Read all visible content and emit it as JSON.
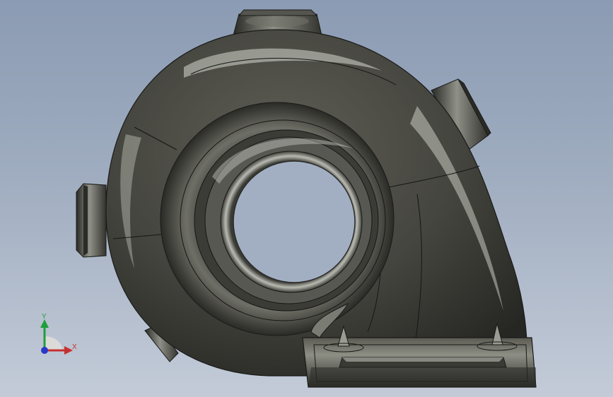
{
  "viewport": {
    "background_top": "#8b9bb3",
    "background_bottom": "#c3cbd8"
  },
  "model": {
    "name": "volute-pump-housing",
    "body_color": "#4a4a44",
    "highlight_color": "#d9dcd3",
    "edge_color": "#1a1a18",
    "bore_color": "#a3b0c4"
  },
  "triad": {
    "x_label": "X",
    "y_label": "Y",
    "x_color": "#c63030",
    "y_color": "#1f9e3c",
    "z_color": "#2838c8"
  }
}
